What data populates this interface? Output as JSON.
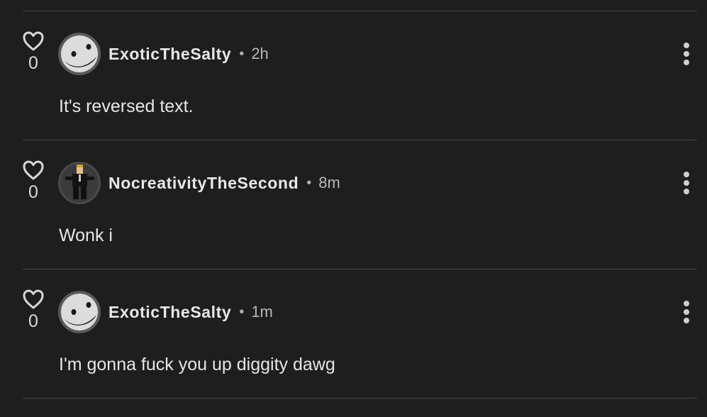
{
  "comments": [
    {
      "username": "ExoticTheSalty",
      "separator": "•",
      "time": "2h",
      "text": "It's reversed text.",
      "likes": "0",
      "avatar": "smiley-face-avatar"
    },
    {
      "username": "NocreativityTheSecond",
      "separator": "•",
      "time": "8m",
      "text": "Wonk i",
      "likes": "0",
      "avatar": "suited-character-avatar"
    },
    {
      "username": "ExoticTheSalty",
      "separator": "•",
      "time": "1m",
      "text": "I'm gonna fuck you up diggity dawg",
      "likes": "0",
      "avatar": "smiley-face-avatar"
    }
  ],
  "icons": {
    "like": "heart-outline-icon",
    "menu": "more-vertical-icon"
  },
  "colors": {
    "background": "#1e1e1e",
    "divider": "#444444",
    "text": "#e6e6e6",
    "muted": "#b8b8b8"
  }
}
